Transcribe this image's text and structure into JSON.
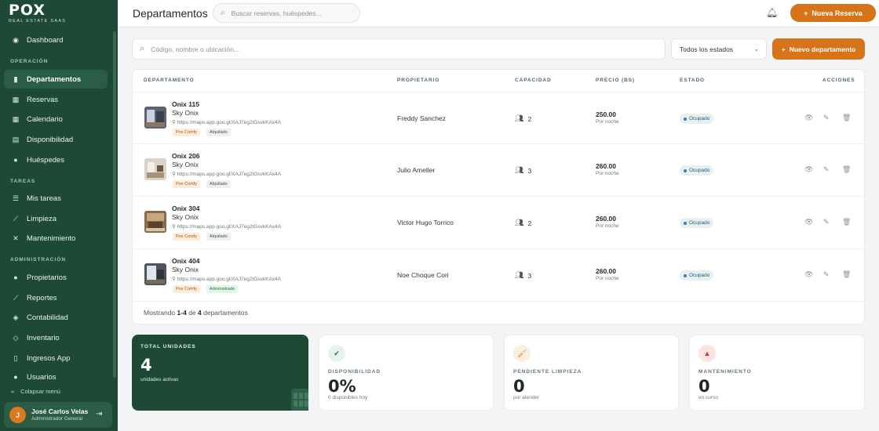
{
  "brand": {
    "logo": "POX",
    "subtitle": "REAL ESTATE SAAS"
  },
  "sidebar": {
    "items_top": [
      {
        "label": "Dashboard",
        "icon": "dashboard-icon"
      }
    ],
    "section_operacion": "OPERACIÓN",
    "operacion": [
      {
        "label": "Departamentos",
        "icon": "building-icon",
        "active": true
      },
      {
        "label": "Reservas",
        "icon": "calendar-check-icon"
      },
      {
        "label": "Calendario",
        "icon": "calendar-icon"
      },
      {
        "label": "Disponibilidad",
        "icon": "grid-icon"
      },
      {
        "label": "Huéspedes",
        "icon": "users-icon"
      }
    ],
    "section_tareas": "TAREAS",
    "tareas": [
      {
        "label": "Mis tareas",
        "icon": "list-icon"
      },
      {
        "label": "Limpieza",
        "icon": "broom-icon"
      },
      {
        "label": "Mantenimiento",
        "icon": "tools-icon"
      }
    ],
    "section_administracion": "ADMINISTRACIÓN",
    "administracion": [
      {
        "label": "Propietarios",
        "icon": "user-icon"
      },
      {
        "label": "Reportes",
        "icon": "chart-icon"
      },
      {
        "label": "Contabilidad",
        "icon": "wallet-icon"
      },
      {
        "label": "Inventario",
        "icon": "box-icon"
      },
      {
        "label": "Ingresos App",
        "icon": "phone-icon"
      },
      {
        "label": "Usuarios",
        "icon": "user-gear-icon"
      }
    ],
    "collapse_label": "Colapsar menú",
    "user": {
      "initial": "J",
      "name": "José Carlos Velasco",
      "role": "Administrador General"
    }
  },
  "header": {
    "title": "Departamentos",
    "search_placeholder": "Buscar reservas, huéspedes...",
    "new_reservation": "Nueva Reserva"
  },
  "filters": {
    "search_placeholder": "Código, nombre o ubicación...",
    "status_selected": "Todos los estados",
    "new_department": "Nuevo departamento"
  },
  "table": {
    "columns": [
      "DEPARTAMENTO",
      "PROPIETARIO",
      "CAPACIDAD",
      "PRECIO (BS)",
      "ESTADO",
      "ACCIONES"
    ],
    "rows": [
      {
        "name": "Onix 115",
        "building": "Sky Onix",
        "url": "https://maps.app.goo.gl/XAJ7eg2tGsvkKAx4A",
        "brand_tag": "Pox Comfy",
        "status_tag": "Alquilado",
        "owner": "Freddy Sanchez",
        "capacity": "2",
        "price": "250.00",
        "price_sub": "Por noche",
        "state": "Ocupado"
      },
      {
        "name": "Onix 206",
        "building": "Sky Onix",
        "url": "https://maps.app.goo.gl/XAJ7eg2tGsvkKAx4A",
        "brand_tag": "Pox Comfy",
        "status_tag": "Alquilado",
        "owner": "Julio Ameller",
        "capacity": "3",
        "price": "260.00",
        "price_sub": "Por noche",
        "state": "Ocupado"
      },
      {
        "name": "Onix 304",
        "building": "Sky Onix",
        "url": "https://maps.app.goo.gl/XAJ7eg2tGsvkKAx4A",
        "brand_tag": "Pox Comfy",
        "status_tag": "Alquilado",
        "owner": "Victor Hugo Torrico",
        "capacity": "2",
        "price": "260.00",
        "price_sub": "Por noche",
        "state": "Ocupado"
      },
      {
        "name": "Onix 404",
        "building": "Sky Onix",
        "url": "https://maps.app.goo.gl/XAJ7eg2tGsvkKAx4A",
        "brand_tag": "Pox Comfy",
        "status_tag": "Administrado",
        "owner": "Noe Choque Cori",
        "capacity": "3",
        "price": "260.00",
        "price_sub": "Por noche",
        "state": "Ocupado"
      }
    ],
    "footer": {
      "prefix": "Mostrando ",
      "range": "1-4",
      "middle": " de ",
      "total": "4",
      "suffix": " departamentos"
    }
  },
  "stats": [
    {
      "label": "TOTAL UNIDADES",
      "value": "4",
      "sub": "unidades activas"
    },
    {
      "label": "DISPONIBILIDAD",
      "value": "0%",
      "sub": "0 disponibles hoy",
      "icon": "check-circle-icon",
      "color": "#1d7a3c"
    },
    {
      "label": "PENDIENTE LIMPIEZA",
      "value": "0",
      "sub": "por atender",
      "icon": "broom-icon",
      "color": "#d77419"
    },
    {
      "label": "MANTENIMIENTO",
      "value": "0",
      "sub": "en curso",
      "icon": "warning-icon",
      "color": "#d0342c"
    }
  ],
  "colors": {
    "sidebar": "#1e4a35",
    "accent": "#d77419",
    "active_item": "#2b5c45"
  }
}
